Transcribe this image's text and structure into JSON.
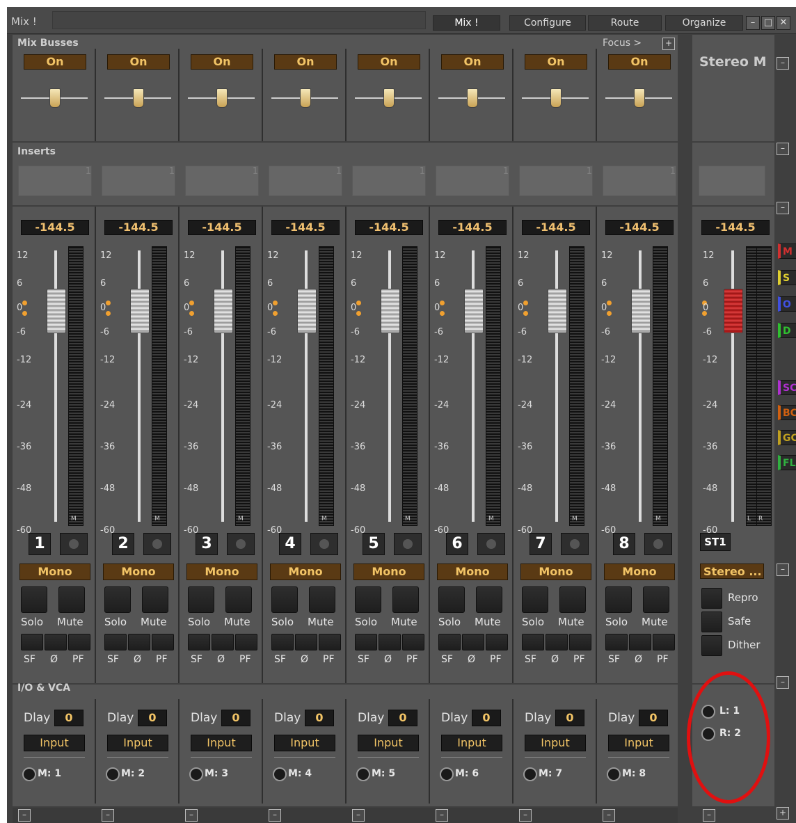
{
  "window": {
    "title": "Mix !",
    "tabs": [
      "Mix !",
      "Configure",
      "Route",
      "Organize"
    ],
    "active_tab": "Mix !",
    "controls": {
      "minimize": "–",
      "maximize": "□",
      "close": "✕"
    }
  },
  "sections": {
    "mix_busses": "Mix Busses",
    "focus": "Focus >",
    "focus_add": "+",
    "inserts": "Inserts",
    "io_vca": "I/O & VCA"
  },
  "channels": [
    {
      "number": "1",
      "on": "On",
      "insert": "1",
      "level": "-144.5",
      "mode": "Mono",
      "solo": "Solo",
      "mute": "Mute",
      "sf": "SF",
      "phase": "Ø",
      "pf": "PF",
      "meter_label": "M",
      "dlay_label": "Dlay",
      "dlay": "0",
      "input": "Input",
      "monitor": "M: 1"
    },
    {
      "number": "2",
      "on": "On",
      "insert": "1",
      "level": "-144.5",
      "mode": "Mono",
      "solo": "Solo",
      "mute": "Mute",
      "sf": "SF",
      "phase": "Ø",
      "pf": "PF",
      "meter_label": "M",
      "dlay_label": "Dlay",
      "dlay": "0",
      "input": "Input",
      "monitor": "M: 2"
    },
    {
      "number": "3",
      "on": "On",
      "insert": "1",
      "level": "-144.5",
      "mode": "Mono",
      "solo": "Solo",
      "mute": "Mute",
      "sf": "SF",
      "phase": "Ø",
      "pf": "PF",
      "meter_label": "M",
      "dlay_label": "Dlay",
      "dlay": "0",
      "input": "Input",
      "monitor": "M: 3"
    },
    {
      "number": "4",
      "on": "On",
      "insert": "1",
      "level": "-144.5",
      "mode": "Mono",
      "solo": "Solo",
      "mute": "Mute",
      "sf": "SF",
      "phase": "Ø",
      "pf": "PF",
      "meter_label": "M",
      "dlay_label": "Dlay",
      "dlay": "0",
      "input": "Input",
      "monitor": "M: 4"
    },
    {
      "number": "5",
      "on": "On",
      "insert": "1",
      "level": "-144.5",
      "mode": "Mono",
      "solo": "Solo",
      "mute": "Mute",
      "sf": "SF",
      "phase": "Ø",
      "pf": "PF",
      "meter_label": "M",
      "dlay_label": "Dlay",
      "dlay": "0",
      "input": "Input",
      "monitor": "M: 5"
    },
    {
      "number": "6",
      "on": "On",
      "insert": "1",
      "level": "-144.5",
      "mode": "Mono",
      "solo": "Solo",
      "mute": "Mute",
      "sf": "SF",
      "phase": "Ø",
      "pf": "PF",
      "meter_label": "M",
      "dlay_label": "Dlay",
      "dlay": "0",
      "input": "Input",
      "monitor": "M: 6"
    },
    {
      "number": "7",
      "on": "On",
      "insert": "1",
      "level": "-144.5",
      "mode": "Mono",
      "solo": "Solo",
      "mute": "Mute",
      "sf": "SF",
      "phase": "Ø",
      "pf": "PF",
      "meter_label": "M",
      "dlay_label": "Dlay",
      "dlay": "0",
      "input": "Input",
      "monitor": "M: 7"
    },
    {
      "number": "8",
      "on": "On",
      "insert": "1",
      "level": "-144.5",
      "mode": "Mono",
      "solo": "Solo",
      "mute": "Mute",
      "sf": "SF",
      "phase": "Ø",
      "pf": "PF",
      "meter_label": "M",
      "dlay_label": "Dlay",
      "dlay": "0",
      "input": "Input",
      "monitor": "M: 8"
    }
  ],
  "fader_scale": [
    "12",
    "6",
    "0",
    "-6",
    "-12",
    "-24",
    "-36",
    "-48",
    "-60"
  ],
  "master": {
    "name": "Stereo M",
    "level": "-144.5",
    "meter_labels": [
      "L",
      "R"
    ],
    "number": "ST1",
    "mode": "Stereo ...",
    "options": [
      "Repro",
      "Safe",
      "Dither"
    ],
    "outputs": [
      "L: 1",
      "R: 2"
    ]
  },
  "side_tabs": [
    {
      "label": "M",
      "color": "#d03030"
    },
    {
      "label": "S",
      "color": "#e0d030"
    },
    {
      "label": "O",
      "color": "#4050e0"
    },
    {
      "label": "D",
      "color": "#30c030"
    },
    {
      "label": "SC",
      "color": "#b030d0"
    },
    {
      "label": "BC",
      "color": "#d06010"
    },
    {
      "label": "GC",
      "color": "#c0a020"
    },
    {
      "label": "FL",
      "color": "#30b040"
    }
  ],
  "colors": {
    "accent_text": "#f2c466",
    "on_button": "#5a3a14",
    "panel": "#555555",
    "annotation": "#e01010"
  }
}
